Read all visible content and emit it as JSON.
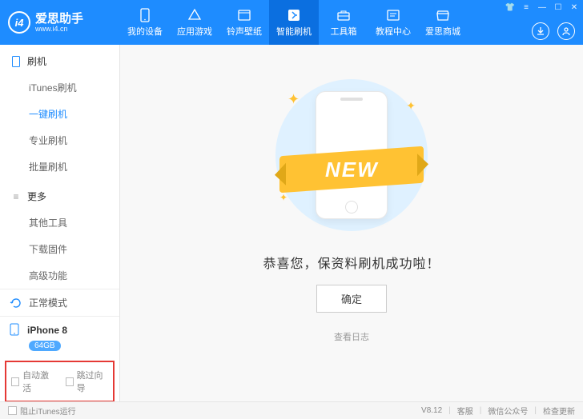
{
  "brand": {
    "name": "爱思助手",
    "url": "www.i4.cn",
    "logo": "i4"
  },
  "nav": [
    {
      "label": "我的设备",
      "icon": "phone-icon"
    },
    {
      "label": "应用游戏",
      "icon": "apps-icon"
    },
    {
      "label": "铃声壁纸",
      "icon": "music-icon"
    },
    {
      "label": "智能刷机",
      "icon": "flash-icon",
      "active": true
    },
    {
      "label": "工具箱",
      "icon": "toolbox-icon"
    },
    {
      "label": "教程中心",
      "icon": "tutorial-icon"
    },
    {
      "label": "爱思商城",
      "icon": "shop-icon"
    }
  ],
  "sidebar": {
    "section1": {
      "title": "刷机",
      "items": [
        "iTunes刷机",
        "一键刷机",
        "专业刷机",
        "批量刷机"
      ],
      "activeIndex": 1
    },
    "section2": {
      "title": "更多",
      "items": [
        "其他工具",
        "下载固件",
        "高级功能"
      ]
    }
  },
  "mode": "正常模式",
  "device": {
    "name": "iPhone 8",
    "storage": "64GB"
  },
  "opts": {
    "autoActivate": "自动激活",
    "skipGuide": "跳过向导"
  },
  "main": {
    "ribbon": "NEW",
    "message": "恭喜您，保资料刷机成功啦！",
    "ok": "确定",
    "log": "查看日志"
  },
  "footer": {
    "blockItunes": "阻止iTunes运行",
    "version": "V8.12",
    "support": "客服",
    "wechat": "微信公众号",
    "update": "检查更新"
  }
}
